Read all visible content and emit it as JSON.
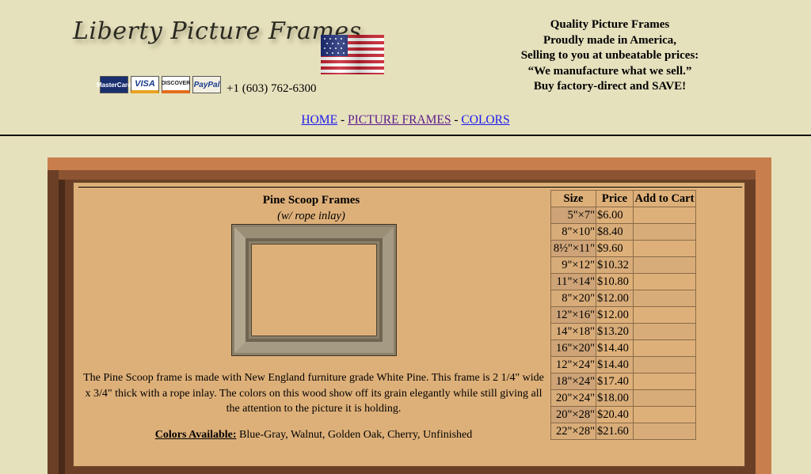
{
  "header": {
    "logo_text": "Liberty Picture Frames",
    "phone": "+1 (603) 762-6300",
    "payment_cards": [
      "MasterCard",
      "VISA",
      "DISCOVER",
      "PayPal"
    ],
    "tagline": [
      "Quality Picture Frames",
      "Proudly made in America,",
      "Selling to you at unbeatable prices:",
      "“We manufacture what we sell.”",
      "Buy factory-direct and SAVE!"
    ]
  },
  "nav": {
    "home": "HOME",
    "picture_frames": "PICTURE FRAMES",
    "colors": "COLORS",
    "separator": "-"
  },
  "product": {
    "title": "Pine Scoop Frames",
    "subtitle": "(w/ rope inlay)",
    "description": "The Pine Scoop frame is made with New England furniture grade White Pine. This frame is 2 1/4\" wide x 3/4\" thick with a rope inlay. The colors on this wood show off its grain elegantly while still giving all the attention to the picture it is holding.",
    "colors_label": "Colors Available:",
    "colors_list": "Blue-Gray, Walnut, Golden Oak, Cherry, Unfinished"
  },
  "price_table": {
    "headers": [
      "Size",
      "Price",
      "Add to Cart"
    ],
    "rows": [
      {
        "size": "5\"×7\"",
        "price": "$6.00"
      },
      {
        "size": "8\"×10\"",
        "price": "$8.40"
      },
      {
        "size": "8½\"×11\"",
        "price": "$9.60"
      },
      {
        "size": "9\"×12\"",
        "price": "$10.32"
      },
      {
        "size": "11\"×14\"",
        "price": "$10.80"
      },
      {
        "size": "8\"×20\"",
        "price": "$12.00"
      },
      {
        "size": "12\"×16\"",
        "price": "$12.00"
      },
      {
        "size": "14\"×18\"",
        "price": "$13.20"
      },
      {
        "size": "16\"×20\"",
        "price": "$14.40"
      },
      {
        "size": "12\"×24\"",
        "price": "$14.40"
      },
      {
        "size": "18\"×24\"",
        "price": "$17.40"
      },
      {
        "size": "20\"×24\"",
        "price": "$18.00"
      },
      {
        "size": "20\"×28\"",
        "price": "$20.40"
      },
      {
        "size": "22\"×28\"",
        "price": "$21.60"
      }
    ]
  },
  "colors": {
    "page_bg": "#e6e1bd",
    "content_bg": "#deb079",
    "link": "#1a1aee",
    "visited_link": "#5a1a8a"
  }
}
